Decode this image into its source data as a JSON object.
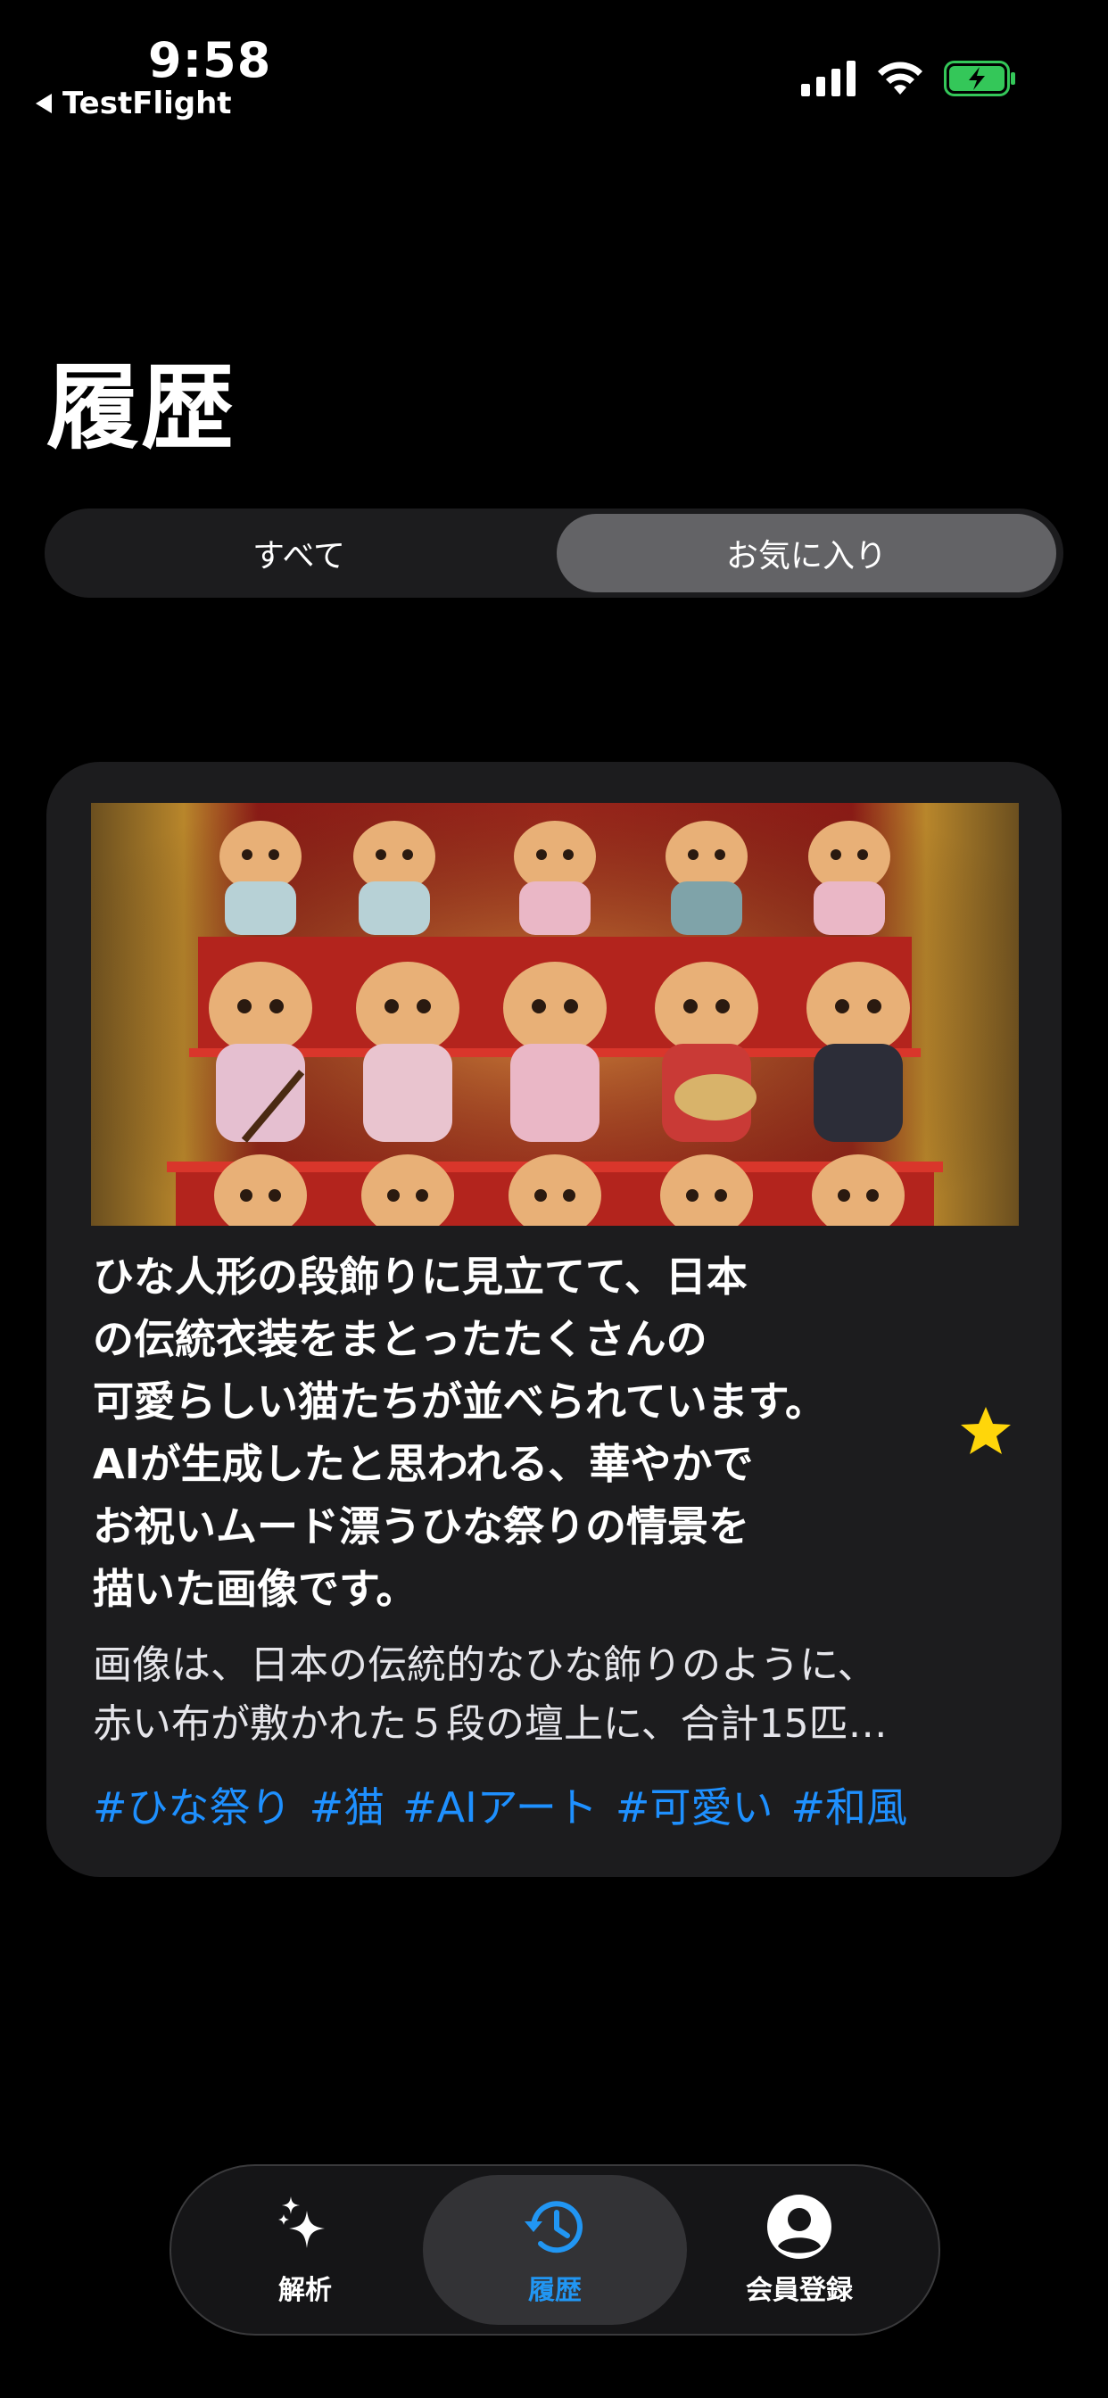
{
  "status_bar": {
    "time": "9:58",
    "back_label": "TestFlight"
  },
  "page": {
    "title": "履歴"
  },
  "segments": {
    "all_label": "すべて",
    "favorites_label": "お気に入り",
    "selected": "お気に入り"
  },
  "card": {
    "title": "ひな人形の段飾りに見立てて、日本\nの伝統衣装をまとったたくさんの\n可愛らしい猫たちが並べられています。\nAIが生成したと思われる、華やかで\nお祝いムード漂うひな祭りの情景を\n描いた画像です。",
    "description": "画像は、日本の伝統的なひな飾りのように、\n赤い布が敷かれた５段の壇上に、合計15匹…",
    "tags": [
      "#ひな祭り",
      "#猫",
      "#AIアート",
      "#可愛い",
      "#和風"
    ],
    "favorited": true,
    "image_icon": "photo-icon"
  },
  "tabbar": {
    "analysis_label": "解析",
    "history_label": "履歴",
    "member_label": "会員登録",
    "active": "履歴"
  },
  "colors": {
    "accent": "#2196f3",
    "tag": "#1e90ff",
    "star": "#ffd60a",
    "battery": "#34c759"
  }
}
